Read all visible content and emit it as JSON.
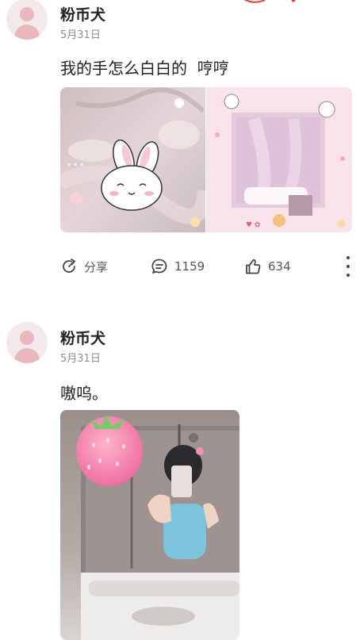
{
  "posts": [
    {
      "author": "粉币犬",
      "date": "5月31日",
      "text": "我的手怎么白白的  哼哼",
      "images": [
        "photo-left-bunny-sticker",
        "photo-right-pink-stickers"
      ],
      "actions": {
        "share_label": "分享",
        "comments": "1159",
        "likes": "634"
      }
    },
    {
      "author": "粉币犬",
      "date": "5月31日",
      "text": "嗷呜。",
      "images": [
        "mirror-selfie-strawberry-sticker"
      ]
    }
  ],
  "colors": {
    "sticker_pink": "#f48fb1",
    "muted_text": "#8d8d8d",
    "accent_red": "#e53935"
  },
  "icons": [
    "share-icon",
    "comment-icon",
    "like-icon",
    "more-icon"
  ]
}
